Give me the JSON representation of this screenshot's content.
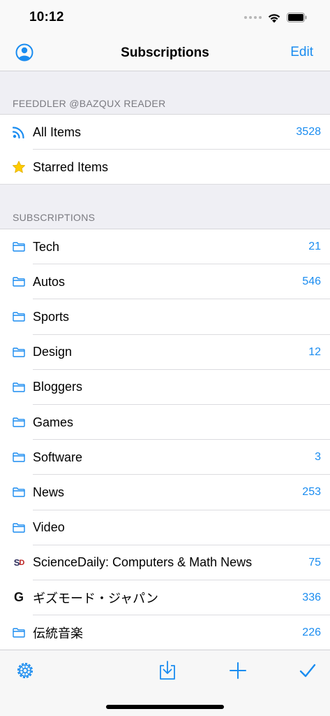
{
  "status_bar": {
    "time": "10:12"
  },
  "nav": {
    "title": "Subscriptions",
    "edit_label": "Edit",
    "left_icon": "user-icon"
  },
  "account_section": {
    "header": "FEEDDLER @BAZQUX READER",
    "items": [
      {
        "label": "All Items",
        "count": "3528",
        "icon": "rss-icon"
      },
      {
        "label": "Starred Items",
        "count": "",
        "icon": "star-icon"
      }
    ]
  },
  "subscriptions_section": {
    "header": "SUBSCRIPTIONS",
    "items": [
      {
        "label": "Tech",
        "count": "21",
        "icon": "folder-icon"
      },
      {
        "label": "Autos",
        "count": "546",
        "icon": "folder-icon"
      },
      {
        "label": "Sports",
        "count": "",
        "icon": "folder-icon"
      },
      {
        "label": "Design",
        "count": "12",
        "icon": "folder-icon"
      },
      {
        "label": "Bloggers",
        "count": "",
        "icon": "folder-icon"
      },
      {
        "label": "Games",
        "count": "",
        "icon": "folder-icon"
      },
      {
        "label": "Software",
        "count": "3",
        "icon": "folder-icon"
      },
      {
        "label": "News",
        "count": "253",
        "icon": "folder-icon"
      },
      {
        "label": "Video",
        "count": "",
        "icon": "folder-icon"
      },
      {
        "label": "ScienceDaily: Computers & Math News",
        "count": "75",
        "icon": "sciencedaily-icon",
        "icon_text_s": "S",
        "icon_text_d": "D"
      },
      {
        "label": "ギズモード・ジャパン",
        "count": "336",
        "icon": "gizmodo-icon",
        "icon_text": "G"
      },
      {
        "label": "伝統音楽",
        "count": "226",
        "icon": "folder-icon"
      }
    ]
  },
  "toolbar": {
    "icons": [
      "settings-gear-icon",
      "download-icon",
      "add-icon",
      "checkmark-icon"
    ]
  },
  "colors": {
    "accent": "#1a8cf0",
    "star": "#ffcc00",
    "background": "#efeff4"
  }
}
